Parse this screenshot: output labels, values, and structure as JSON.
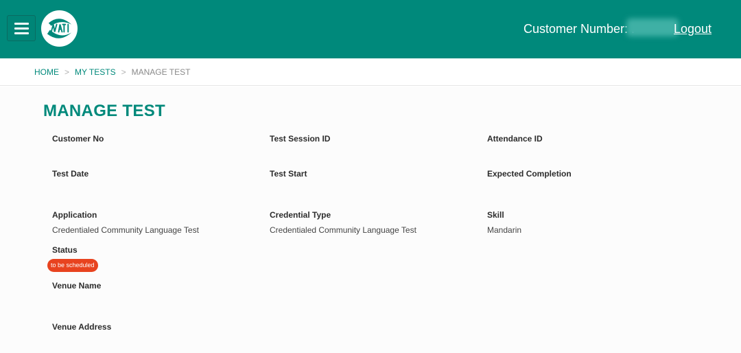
{
  "header": {
    "customer_label": "Customer Number: .",
    "logout_label": "Logout",
    "logo": "naati-logo-icon",
    "menu_icon": "hamburger-menu-icon"
  },
  "breadcrumb": {
    "home": "HOME",
    "my_tests": "MY TESTS",
    "current": "MANAGE TEST",
    "separator": ">"
  },
  "page": {
    "title": "MANAGE TEST"
  },
  "fields": {
    "customer_no": {
      "label": "Customer No",
      "value": ""
    },
    "test_session_id": {
      "label": "Test Session ID",
      "value": ""
    },
    "attendance_id": {
      "label": "Attendance ID",
      "value": ""
    },
    "test_date": {
      "label": "Test Date",
      "value": ""
    },
    "test_start": {
      "label": "Test Start",
      "value": ""
    },
    "expected_completion": {
      "label": "Expected Completion",
      "value": ""
    },
    "application": {
      "label": "Application",
      "value": "Credentialed Community Language Test"
    },
    "credential_type": {
      "label": "Credential Type",
      "value": "Credentialed Community Language Test"
    },
    "skill": {
      "label": "Skill",
      "value": "Mandarin"
    },
    "status": {
      "label": "Status",
      "badge": "to be scheduled"
    },
    "venue_name": {
      "label": "Venue Name",
      "value": ""
    },
    "venue_address": {
      "label": "Venue Address",
      "value": ""
    }
  },
  "colors": {
    "brand": "#00897b",
    "status_badge": "#e8431f"
  }
}
